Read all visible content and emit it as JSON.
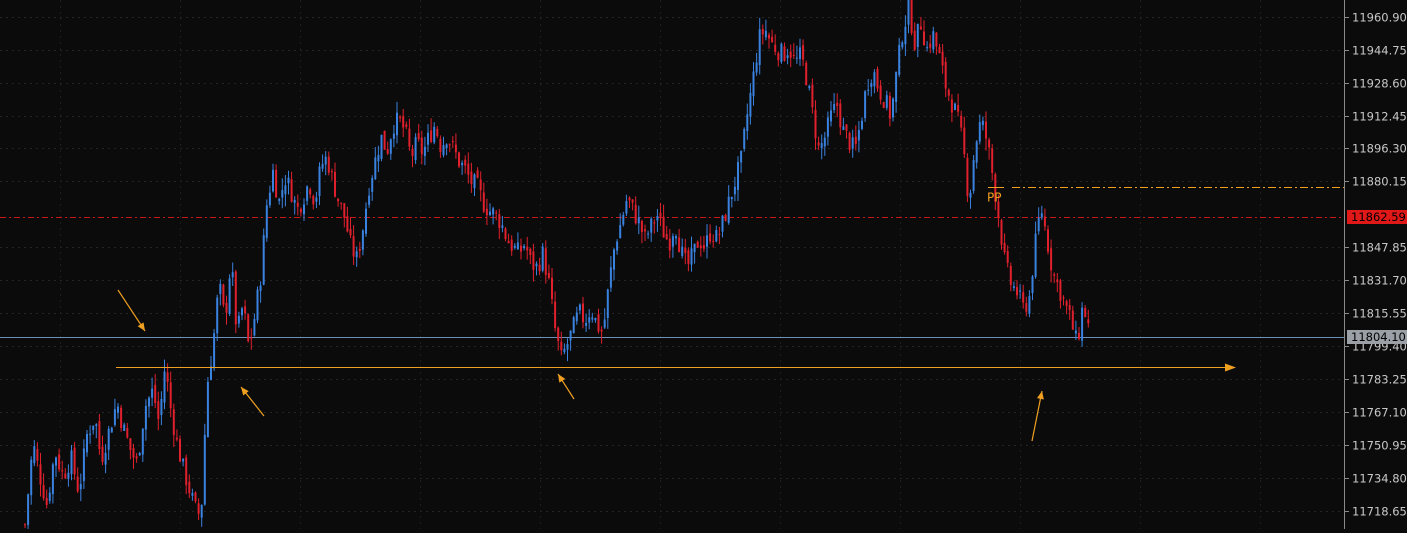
{
  "chart_data": {
    "type": "candlestick",
    "title": "",
    "xlabel": "",
    "ylabel": "",
    "ylim": [
      11710.0,
      11969.0
    ],
    "grid": true,
    "y_ticks": [
      "11960.90",
      "11944.75",
      "11928.60",
      "11912.45",
      "11896.30",
      "11880.15",
      "11847.85",
      "11831.70",
      "11815.55",
      "11799.40",
      "11783.25",
      "11767.10",
      "11750.95",
      "11734.80",
      "11718.65"
    ],
    "price_tags": [
      {
        "label": "11862.59",
        "value": 11862.59,
        "color": "#e01818",
        "text_color": "#000000"
      },
      {
        "label": "11804.10",
        "value": 11804.1,
        "color": "#9aa0a6",
        "text_color": "#000000"
      }
    ],
    "reference_lines": [
      {
        "kind": "current-price",
        "value": 11804.1,
        "color": "#6d8fb8"
      },
      {
        "kind": "ask-line",
        "value": 11862.59,
        "color": "#c81818"
      }
    ],
    "pivot": {
      "label": "PP",
      "value": 11877.5,
      "color": "#f0a020"
    },
    "support": {
      "value": 11789.5,
      "color": "#f0a020"
    },
    "arrows_color": "#f0a020",
    "up_color": "#3a82e0",
    "down_color": "#e0202c",
    "series": [
      {
        "points": [
          [
            0,
            11712
          ],
          [
            8,
            11752
          ],
          [
            14,
            11738
          ],
          [
            22,
            11722
          ],
          [
            30,
            11748
          ],
          [
            38,
            11736
          ],
          [
            46,
            11745
          ],
          [
            54,
            11728
          ],
          [
            62,
            11756
          ],
          [
            70,
            11765
          ],
          [
            76,
            11744
          ],
          [
            84,
            11758
          ],
          [
            92,
            11772
          ],
          [
            98,
            11760
          ],
          [
            106,
            11748
          ],
          [
            112,
            11742
          ],
          [
            120,
            11770
          ],
          [
            128,
            11778
          ],
          [
            134,
            11762
          ],
          [
            140,
            11790
          ],
          [
            146,
            11768
          ],
          [
            152,
            11752
          ],
          [
            158,
            11740
          ],
          [
            164,
            11730
          ],
          [
            170,
            11720
          ],
          [
            176,
            11716
          ],
          [
            182,
            11780
          ],
          [
            188,
            11800
          ],
          [
            194,
            11830
          ],
          [
            200,
            11812
          ],
          [
            206,
            11842
          ],
          [
            212,
            11805
          ],
          [
            218,
            11820
          ],
          [
            224,
            11798
          ],
          [
            230,
            11815
          ],
          [
            236,
            11835
          ],
          [
            242,
            11870
          ],
          [
            248,
            11885
          ],
          [
            254,
            11870
          ],
          [
            260,
            11882
          ],
          [
            266,
            11876
          ],
          [
            272,
            11866
          ],
          [
            278,
            11872
          ],
          [
            284,
            11880
          ],
          [
            290,
            11870
          ],
          [
            296,
            11888
          ],
          [
            302,
            11892
          ],
          [
            308,
            11880
          ],
          [
            314,
            11870
          ],
          [
            320,
            11862
          ],
          [
            326,
            11848
          ],
          [
            332,
            11842
          ],
          [
            338,
            11858
          ],
          [
            344,
            11878
          ],
          [
            350,
            11890
          ],
          [
            356,
            11902
          ],
          [
            362,
            11895
          ],
          [
            368,
            11908
          ],
          [
            374,
            11910
          ],
          [
            380,
            11905
          ],
          [
            386,
            11892
          ],
          [
            392,
            11899
          ],
          [
            398,
            11894
          ],
          [
            404,
            11902
          ],
          [
            410,
            11908
          ],
          [
            416,
            11897
          ],
          [
            422,
            11903
          ],
          [
            428,
            11896
          ],
          [
            434,
            11890
          ],
          [
            440,
            11886
          ],
          [
            446,
            11880
          ],
          [
            452,
            11878
          ],
          [
            458,
            11870
          ],
          [
            464,
            11866
          ],
          [
            470,
            11864
          ],
          [
            476,
            11860
          ],
          [
            482,
            11852
          ],
          [
            488,
            11848
          ],
          [
            494,
            11845
          ],
          [
            500,
            11850
          ],
          [
            506,
            11840
          ],
          [
            512,
            11838
          ],
          [
            518,
            11845
          ],
          [
            524,
            11830
          ],
          [
            530,
            11808
          ],
          [
            536,
            11793
          ],
          [
            542,
            11800
          ],
          [
            548,
            11808
          ],
          [
            554,
            11816
          ],
          [
            560,
            11812
          ],
          [
            566,
            11818
          ],
          [
            572,
            11810
          ],
          [
            578,
            11806
          ],
          [
            584,
            11830
          ],
          [
            590,
            11850
          ],
          [
            596,
            11860
          ],
          [
            602,
            11872
          ],
          [
            608,
            11866
          ],
          [
            614,
            11860
          ],
          [
            620,
            11852
          ],
          [
            626,
            11858
          ],
          [
            632,
            11864
          ],
          [
            638,
            11856
          ],
          [
            644,
            11850
          ],
          [
            650,
            11860
          ],
          [
            656,
            11846
          ],
          [
            662,
            11838
          ],
          [
            668,
            11844
          ],
          [
            674,
            11852
          ],
          [
            680,
            11848
          ],
          [
            686,
            11856
          ],
          [
            692,
            11852
          ],
          [
            698,
            11860
          ],
          [
            704,
            11870
          ],
          [
            710,
            11880
          ],
          [
            716,
            11890
          ],
          [
            722,
            11912
          ],
          [
            728,
            11930
          ],
          [
            734,
            11950
          ],
          [
            740,
            11955
          ],
          [
            746,
            11948
          ],
          [
            752,
            11945
          ],
          [
            758,
            11942
          ],
          [
            764,
            11946
          ],
          [
            770,
            11938
          ],
          [
            776,
            11942
          ],
          [
            782,
            11930
          ],
          [
            788,
            11912
          ],
          [
            794,
            11895
          ],
          [
            800,
            11902
          ],
          [
            806,
            11912
          ],
          [
            812,
            11918
          ],
          [
            818,
            11905
          ],
          [
            824,
            11900
          ],
          [
            830,
            11895
          ],
          [
            836,
            11910
          ],
          [
            842,
            11928
          ],
          [
            848,
            11935
          ],
          [
            854,
            11925
          ],
          [
            860,
            11920
          ],
          [
            866,
            11912
          ],
          [
            872,
            11935
          ],
          [
            878,
            11955
          ],
          [
            884,
            11965
          ],
          [
            890,
            11948
          ],
          [
            896,
            11958
          ],
          [
            902,
            11945
          ],
          [
            908,
            11952
          ],
          [
            914,
            11942
          ],
          [
            920,
            11928
          ],
          [
            926,
            11920
          ],
          [
            932,
            11912
          ],
          [
            938,
            11898
          ],
          [
            944,
            11870
          ],
          [
            950,
            11898
          ],
          [
            956,
            11910
          ],
          [
            962,
            11900
          ],
          [
            968,
            11882
          ],
          [
            974,
            11862
          ],
          [
            980,
            11840
          ],
          [
            986,
            11830
          ],
          [
            992,
            11826
          ],
          [
            998,
            11818
          ],
          [
            1004,
            11822
          ],
          [
            1010,
            11848
          ],
          [
            1016,
            11868
          ],
          [
            1022,
            11852
          ],
          [
            1028,
            11835
          ],
          [
            1034,
            11828
          ],
          [
            1040,
            11820
          ],
          [
            1046,
            11812
          ],
          [
            1052,
            11800
          ],
          [
            1058,
            11820
          ],
          [
            1064,
            11808
          ]
        ]
      }
    ]
  }
}
